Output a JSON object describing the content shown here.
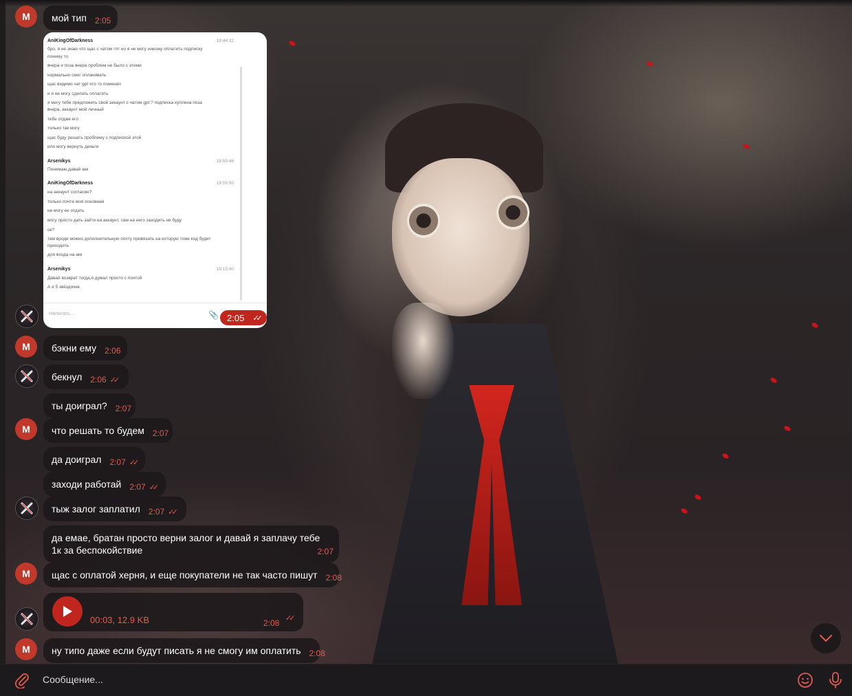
{
  "sender_initial": "M",
  "messages": [
    {
      "text": "мой тип",
      "time": "2:05"
    },
    {
      "text": "бэкни ему",
      "time": "2:06"
    },
    {
      "text": "бекнул",
      "time": "2:06"
    },
    {
      "text": "ты доиграл?",
      "time": "2:07"
    },
    {
      "text": "что решать то будем",
      "time": "2:07"
    },
    {
      "text": "да доиграл",
      "time": "2:07"
    },
    {
      "text": "заходи работай",
      "time": "2:07"
    },
    {
      "text": "тыж залог заплатил",
      "time": "2:07"
    },
    {
      "text": "да емае, братан просто верни залог и давай я заплачу тебе 1к за беспокойствие",
      "time": "2:07"
    },
    {
      "text": "щас с оплатой херня, и еще покупатели не так часто пишут",
      "time": "2:08"
    },
    {
      "text": "ну типо даже если будут писать я не смогу им оплатить",
      "time": "2:08"
    }
  ],
  "image_message": {
    "time": "2:05",
    "screenshot": {
      "blocks": [
        {
          "name": "AniKingOfDarkness",
          "time": "18:44:32",
          "lines": [
            "бро, я не знаю что щас с чатом гпт но я не могу никому оплатить подписку",
            "почему то",
            "вчера и поза вчера проблем не было с этими",
            "нормально смог оплачивать",
            "щас видимо чат gpt что то поменял",
            "и я не могу сделать оплатить",
            "я могу тебе предложить свой аккаунт с чатом gpt ? подписка куплена поза",
            "вчера, аккаунт мой личный",
            "тебе отдам его",
            "только так могу",
            "щас буду решать проблему с подпиской этой",
            "или могу вернуть деньги"
          ]
        },
        {
          "name": "Arsenikys",
          "time": "18:55:46",
          "lines": [
            "Понимаю,давай акк"
          ]
        },
        {
          "name": "AniKingOfDarkness",
          "time": "19:05:50",
          "lines": [
            "на аккаунт согласен?",
            "только почта моя основная",
            "не могу ее отдать",
            "могу просто дать зайти на аккаунт, сам на него заходить не буду",
            "ок?",
            "там вроде можно дополнительную почту привязать на которую тоже код будет",
            "приходить",
            "для входа на акк"
          ]
        },
        {
          "name": "Arsenikys",
          "time": "19:15:40",
          "lines": [
            "Давай возврат тогда,я думал просто с почтой",
            "А я 5 звёздочек"
          ]
        }
      ],
      "input_placeholder": "Написать..."
    }
  },
  "voice_message": {
    "meta": "00:03, 12.9 KB",
    "time": "2:08"
  },
  "composer": {
    "placeholder": "Сообщение..."
  },
  "colors": {
    "accent": "#c0261d",
    "time_text": "#e35b4f",
    "bubble_bg": "#1c181a"
  }
}
